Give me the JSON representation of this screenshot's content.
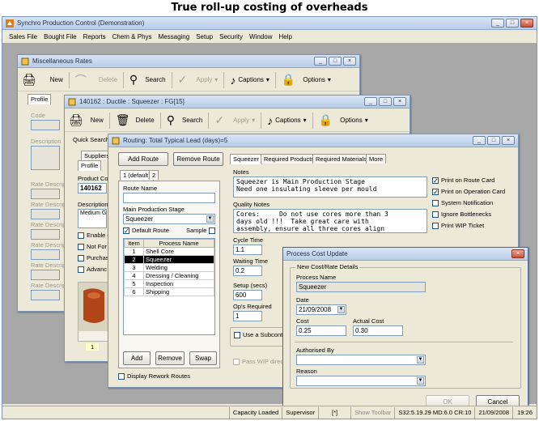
{
  "caption": "True roll-up costing of overheads",
  "app": {
    "title": "Synchro Production Control (Demonstration)",
    "menu": [
      "Sales File",
      "Bought File",
      "Reports",
      "Chem & Phys",
      "Messaging",
      "Setup",
      "Security",
      "Window",
      "Help"
    ]
  },
  "misc_rates": {
    "title": "Miscellaneous Rates",
    "toolbar": {
      "new": "New",
      "delete": "Delete",
      "search": "Search",
      "apply": "Apply",
      "captions": "Captions",
      "options": "Options"
    },
    "tab": "Profile",
    "labels": {
      "code": "Code",
      "description": "Description",
      "rate_desc": "Rate Descrip"
    }
  },
  "product": {
    "title": "140162 : Ductile : Squeezer : FG[15]",
    "toolbar": {
      "new": "New",
      "delete": "Delete",
      "search": "Search",
      "apply": "Apply",
      "captions": "Captions",
      "options": "Options"
    },
    "quick_search": "Quick Search",
    "tabs": [
      "Suppliers",
      "Profile"
    ],
    "product_code_label": "Product Co",
    "product_code": "140162",
    "description_label": "Description",
    "description": "Medium Gla",
    "checks": [
      "Enable c",
      "Not For",
      "Purchas",
      "Advanc"
    ],
    "thumb_label": "1"
  },
  "routing": {
    "title": "Routing: Total Typical Lead (days)=5",
    "add_route": "Add Route",
    "remove_route": "Remove Route",
    "route_tabs": [
      "1 (default)",
      "2"
    ],
    "route_name_label": "Route Name",
    "route_name": "",
    "main_stage_label": "Main Production Stage",
    "main_stage": "Squeezer",
    "default_route": "Default Route",
    "sample": "Sample",
    "process_headers": [
      "Item",
      "Process Name"
    ],
    "processes": [
      {
        "item": "1",
        "name": "Shell Core"
      },
      {
        "item": "2",
        "name": "Squeezer"
      },
      {
        "item": "3",
        "name": "Welding"
      },
      {
        "item": "4",
        "name": "Dressing / Cleaning"
      },
      {
        "item": "5",
        "name": "Inspection"
      },
      {
        "item": "6",
        "name": "Shipping"
      }
    ],
    "add": "Add",
    "remove": "Remove",
    "swap": "Swap",
    "display_rework": "Display Rework Routes",
    "right_tabs": [
      "Squeezer",
      "Required Products",
      "Required Materials",
      "More"
    ],
    "notes_label": "Notes",
    "notes": "Squeezer is Main Production Stage\nNeed one insulating sleeve per mould",
    "quality_label": "Quality Notes",
    "quality": "Cores:     Do not use cores more than 3\ndays old !!!  Take great care with\nassembly, ensure all three cores align",
    "cycle_label": "Cycle Time",
    "cycle": "1.1",
    "waiting_label": "Waiting Time",
    "waiting": "0.2",
    "setup_label": "Setup (secs)",
    "setup": "600",
    "ops_label": "Op's Required",
    "ops": "1",
    "use_subcontractor": "Use a Subcontrac",
    "pass_wip": "Pass WIP direct t",
    "right_checks": [
      {
        "label": "Print on Route Card",
        "checked": true
      },
      {
        "label": "Print on Operation Card",
        "checked": true
      },
      {
        "label": "System Notification",
        "checked": false
      },
      {
        "label": "Ignore Bottlenecks",
        "checked": false
      },
      {
        "label": "Print WIP Ticket",
        "checked": false
      }
    ]
  },
  "dialog": {
    "title": "Process Cost Update",
    "group": "New Cost/Rate Details",
    "process_name_label": "Process Name",
    "process_name": "Squeezer",
    "date_label": "Date",
    "date": "21/09/2008",
    "cost_label": "Cost",
    "cost": "0.25",
    "actual_cost_label": "Actual Cost",
    "actual_cost": "0.30",
    "authorised_label": "Authorised By",
    "authorised": "",
    "reason_label": "Reason",
    "reason": "",
    "ok": "OK",
    "cancel": "Cancel"
  },
  "status": {
    "capacity": "Capacity Loaded",
    "user": "Supervisor",
    "flag": "[*]",
    "show_toolbar": "Show Toolbar",
    "server": "S32:5.19.29 MD:6.0 CR:10",
    "date": "21/09/2008",
    "time": "19:26"
  },
  "colors": {
    "mdi_bg": "#a8a8a8",
    "selection": "#000000",
    "title_gradient": "#b9cde7"
  }
}
